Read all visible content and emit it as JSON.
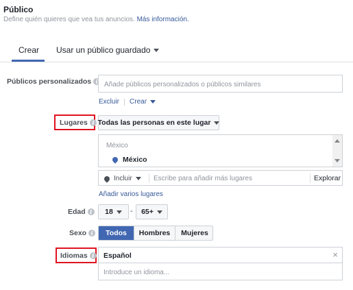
{
  "header": {
    "title": "Público",
    "subtitle": "Define quién quieres que vea tus anuncios.",
    "more_info_link": "Más información."
  },
  "tabs": [
    {
      "label": "Crear",
      "active": true
    },
    {
      "label": "Usar un público guardado",
      "active": false
    }
  ],
  "custom_audiences": {
    "label": "Públicos personalizados",
    "placeholder": "Añade públicos personalizados o públicos similares",
    "exclude_link": "Excluir",
    "create_link": "Crear"
  },
  "locations": {
    "label": "Lugares",
    "dropdown_value": "Todas las personas en este lugar",
    "country_header": "México",
    "selected_location": "México",
    "include_value": "Incluir",
    "search_placeholder": "Escribe para añadir más lugares",
    "explore_button": "Explorar",
    "add_multiple_link": "Añadir varios lugares"
  },
  "age": {
    "label": "Edad",
    "min": "18",
    "max": "65+",
    "separator": "-"
  },
  "gender": {
    "label": "Sexo",
    "options": [
      "Todos",
      "Hombres",
      "Mujeres"
    ],
    "selected": "Todos"
  },
  "languages": {
    "label": "Idiomas",
    "selected": "Español",
    "placeholder": "Introduce un idioma...",
    "remove_glyph": "×"
  },
  "colors": {
    "accent": "#4267b2",
    "highlight_box": "#e0121e",
    "link": "#365899"
  }
}
